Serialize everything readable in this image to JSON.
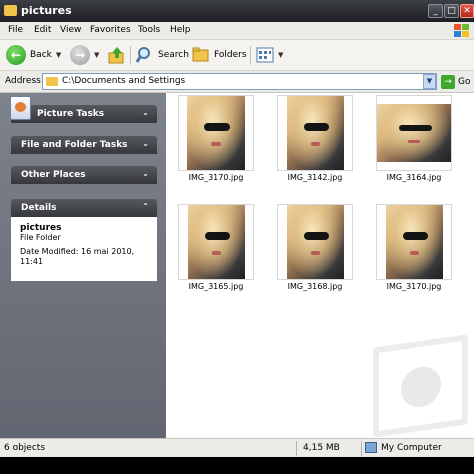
{
  "window": {
    "title": "pictures"
  },
  "menu": [
    "File",
    "Edit",
    "View",
    "Favorites",
    "Tools",
    "Help"
  ],
  "toolbar": {
    "back": "Back",
    "search": "Search",
    "folders": "Folders"
  },
  "address": {
    "label": "Address",
    "path": "C:\\Documents and Settings",
    "go": "Go"
  },
  "sidebar": {
    "picture_tasks": "Picture Tasks",
    "file_folder_tasks": "File and Folder Tasks",
    "other_places": "Other Places",
    "details": {
      "title": "Details",
      "name": "pictures",
      "type": "File Folder",
      "date_line1": "Date Modified: 16 mai 2010,",
      "date_line2": "11:41"
    }
  },
  "files": [
    {
      "name": "IMG_3170.jpg"
    },
    {
      "name": "IMG_3142.jpg"
    },
    {
      "name": "IMG_3164.jpg"
    },
    {
      "name": "IMG_3165.jpg"
    },
    {
      "name": "IMG_3168.jpg"
    },
    {
      "name": "IMG_3170.jpg"
    }
  ],
  "status": {
    "count": "6 objects",
    "size": "4,15 MB",
    "location": "My Computer"
  }
}
